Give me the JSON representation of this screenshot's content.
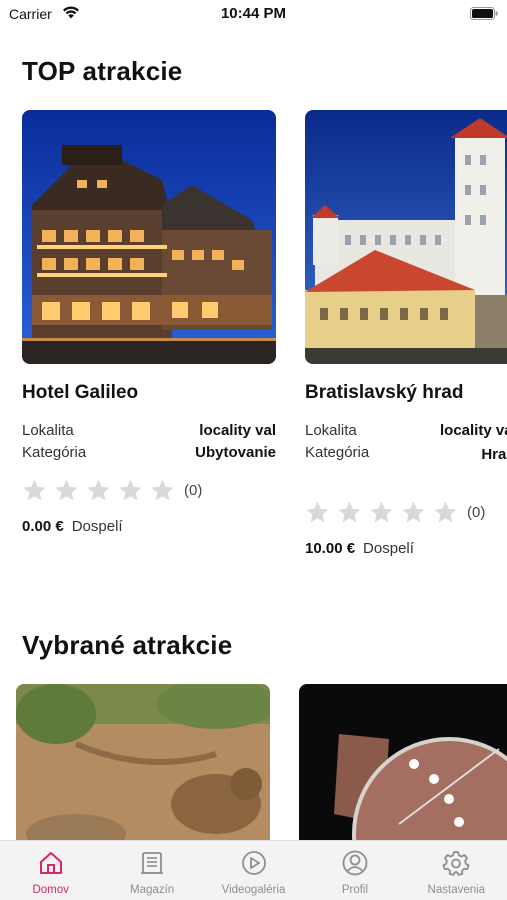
{
  "status_bar": {
    "carrier": "Carrier",
    "time": "10:44 PM"
  },
  "top_section": {
    "title": "TOP atrakcie",
    "cards": [
      {
        "name": "Hotel Galileo",
        "locality_label": "Lokalita",
        "locality_value": "locality val",
        "category_label": "Kategória",
        "category_value": "Ubytovanie",
        "rating_stars": 0,
        "rating_count": "(0)",
        "price": "0.00 €",
        "price_unit": "Dospelí"
      },
      {
        "name": "Bratislavský hrad",
        "locality_label": "Lokalita",
        "locality_value": "locality val",
        "category_label": "Kategória",
        "category_value": "Hrady, zámky, kaštiele",
        "rating_stars": 0,
        "rating_count": "(0)",
        "price": "10.00 €",
        "price_unit": "Dospelí"
      }
    ]
  },
  "selected_section": {
    "title": "Vybrané atrakcie"
  },
  "tab_bar": {
    "active_color": "#e0245e",
    "inactive_color": "#8e8e93",
    "items": [
      {
        "label": "Domov",
        "icon": "home-icon",
        "active": true
      },
      {
        "label": "Magazín",
        "icon": "magazine-icon",
        "active": false
      },
      {
        "label": "Videogaléria",
        "icon": "play-circle-icon",
        "active": false
      },
      {
        "label": "Profil",
        "icon": "profile-icon",
        "active": false
      },
      {
        "label": "Nastavenia",
        "icon": "gear-icon",
        "active": false
      }
    ]
  }
}
